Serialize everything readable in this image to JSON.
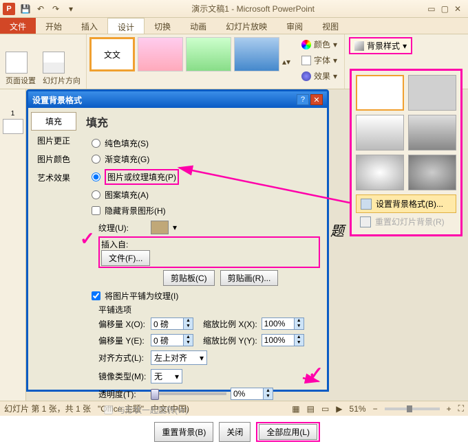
{
  "titlebar": {
    "title": "演示文稿1 - Microsoft PowerPoint"
  },
  "ribbon_tabs": {
    "file": "文件",
    "home": "开始",
    "insert": "插入",
    "design": "设计",
    "transition": "切换",
    "animation": "动画",
    "slideshow": "幻灯片放映",
    "review": "审阅",
    "view": "视图"
  },
  "ribbon": {
    "page_setup": "页面设置",
    "orientation": "幻灯片方向",
    "colors": "颜色",
    "fonts": "字体",
    "effects": "效果",
    "bg_styles": "背景样式"
  },
  "bg_dropdown": {
    "format_bg": "设置背景格式(B)...",
    "reset_bg": "重置幻灯片背景(R)"
  },
  "dialog": {
    "title": "设置背景格式",
    "nav": {
      "fill": "填充",
      "pic_correct": "图片更正",
      "pic_color": "图片颜色",
      "artistic": "艺术效果"
    },
    "heading": "填充",
    "radios": {
      "solid": "纯色填充(S)",
      "gradient": "渐变填充(G)",
      "picture": "图片或纹理填充(P)",
      "pattern": "图案填充(A)"
    },
    "hide_bg": "隐藏背景图形(H)",
    "texture_label": "纹理(U):",
    "insert_from": "插入自:",
    "file_btn": "文件(F)...",
    "clipboard_btn": "剪贴板(C)",
    "clipart_btn": "剪贴画(R)...",
    "tile_check": "将图片平铺为纹理(I)",
    "tile_heading": "平铺选项",
    "offset_x": "偏移量 X(O):",
    "offset_y": "偏移量 Y(E):",
    "scale_x": "缩放比例 X(X):",
    "scale_y": "缩放比例 Y(Y):",
    "align": "对齐方式(L):",
    "mirror": "镜像类型(M):",
    "transparency": "透明度(T):",
    "rotate_with_shape": "与形状一起旋转(W)",
    "values": {
      "offset_x": "0 磅",
      "offset_y": "0 磅",
      "scale_x": "100%",
      "scale_y": "100%",
      "align": "左上对齐",
      "mirror": "无",
      "transparency": "0%"
    },
    "footer": {
      "reset": "重置背景(B)",
      "close": "关闭",
      "apply_all": "全部应用(L)"
    }
  },
  "statusbar": {
    "slide_info": "幻灯片 第 1 张，共 1 张",
    "theme": "\"Office 主题\"",
    "lang": "中文(中国)",
    "zoom": "51%"
  },
  "slide_placeholder": "题"
}
